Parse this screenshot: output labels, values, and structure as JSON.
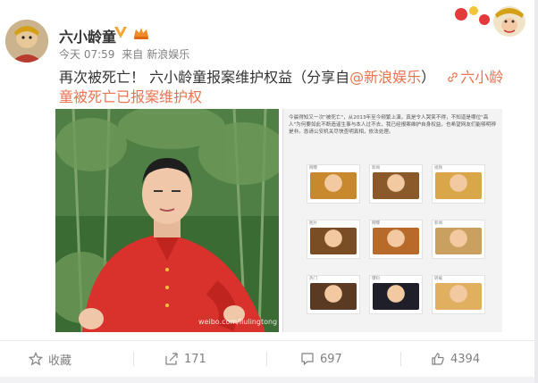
{
  "post": {
    "username": "六小龄童",
    "time": "今天 07:59",
    "from_prefix": "来自",
    "source": "新浪娱乐",
    "text_main": "再次被死亡！ 六小龄童报案维护权益（分享自",
    "mention": "@新浪娱乐",
    "text_close": "）",
    "link_text": "六小龄童被死亡已报案维护权",
    "watermark": "weibo.com/liulingtong"
  },
  "article_image": {
    "intro": "今晨得知又一次\"被死亡\"，从2013年至今频繁上演，真是令人哭笑不得，不知道是哪位\"高人\"为何要如此不断造谣生事与本人过不去，我已经报案维护自身权益，也希望网友们能够明辨是非。恳请公安机关尽快查明真相，依法处理。",
    "captions": [
      "网曝",
      "新闻",
      "视频",
      "图片",
      "网曝",
      "新闻",
      "热门",
      "爆料",
      "转载"
    ]
  },
  "actions": [
    {
      "icon": "star-icon",
      "label": "收藏"
    },
    {
      "icon": "share-icon",
      "label": "171"
    },
    {
      "icon": "comment-icon",
      "label": "697"
    },
    {
      "icon": "like-icon",
      "label": "4394"
    }
  ],
  "colors": {
    "accent": "#eb7350",
    "vip_gold": "#f3a536",
    "text": "#333333",
    "meta": "#808080"
  }
}
